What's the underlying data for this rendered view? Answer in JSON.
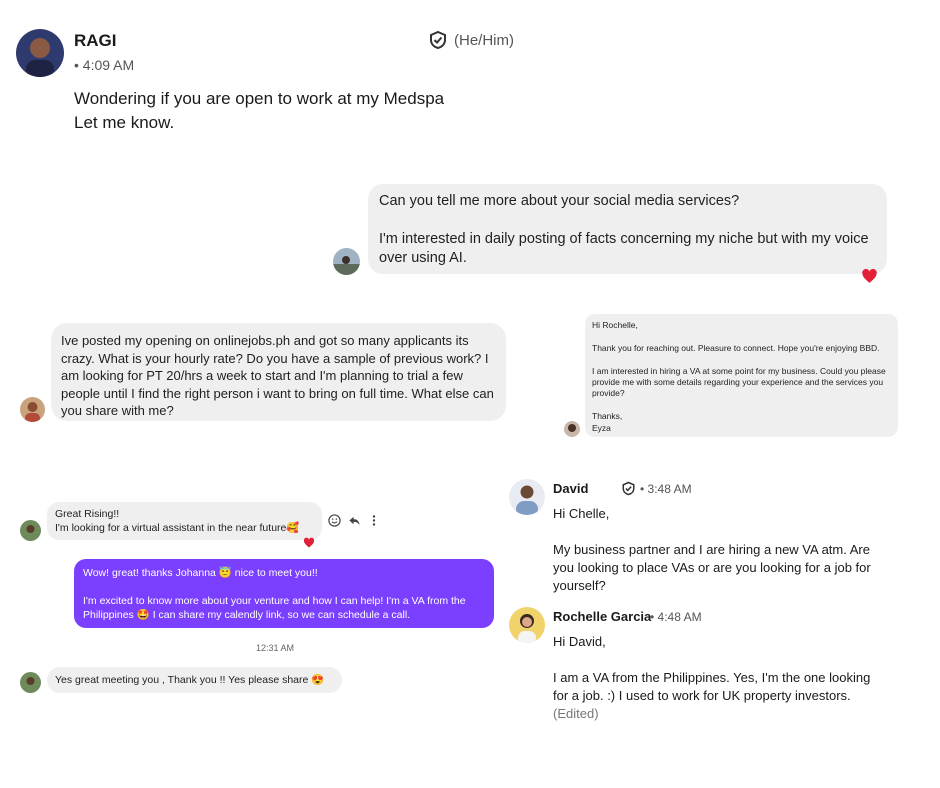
{
  "msg1": {
    "name": "RAGI",
    "pronouns": "(He/Him)",
    "time": "• 4:09 AM",
    "text": "Wondering if you are open to work at my Medspa\nLet me know."
  },
  "msg2": {
    "text": "Can you tell me more about your social media services?\n\nI'm interested in daily posting of facts concerning my niche but with my voice over using AI.",
    "reaction": "heart"
  },
  "msg3": {
    "text": "Ive posted my opening on onlinejobs.ph and got so many applicants its crazy. What is your hourly rate? Do you have a sample of previous work? I am looking for PT 20/hrs a week to start and I'm planning to trial a few people until I find the right person i want to bring on full time. What else can you share with me?"
  },
  "msg4": {
    "text": "Hi Rochelle,\n\nThank you for reaching out. Pleasure to connect. Hope you're enjoying BBD.\n\nI am interested in hiring a VA at some point for my business. Could you please provide me with some details regarding your experience and the services you provide?\n\nThanks,\nEyza"
  },
  "chat5": {
    "incoming1": "Great Rising!!\nI'm looking for a virtual assistant in the near future🥰",
    "reaction": "heart",
    "actions": [
      "smile-icon",
      "reply-icon",
      "more-icon"
    ],
    "outgoing": "Wow! great! thanks Johanna 😇 nice to meet you!!\n\nI'm excited to know more about your venture and how I can help! I'm a VA from the Philippines 🤩 I can share my calendly link, so we can schedule a call.",
    "timestamp": "12:31 AM",
    "incoming2": "Yes great meeting you , Thank you !! Yes please share 😍",
    "colors": {
      "outgoing_bg": "#7b3fff"
    }
  },
  "chat6": {
    "david": {
      "name": "David",
      "time": "• 3:48 AM",
      "text": "Hi Chelle,\n\nMy business partner and I are hiring a new VA atm. Are you looking to place VAs or are you looking for a job for yourself?"
    },
    "rochelle": {
      "name": "Rochelle Garcia",
      "time": "• 4:48 AM",
      "text": "Hi David,\n\nI am a VA from the Philippines. Yes, I'm the one looking for a job. :) I used to work for UK property investors.",
      "edited": "(Edited)"
    }
  }
}
